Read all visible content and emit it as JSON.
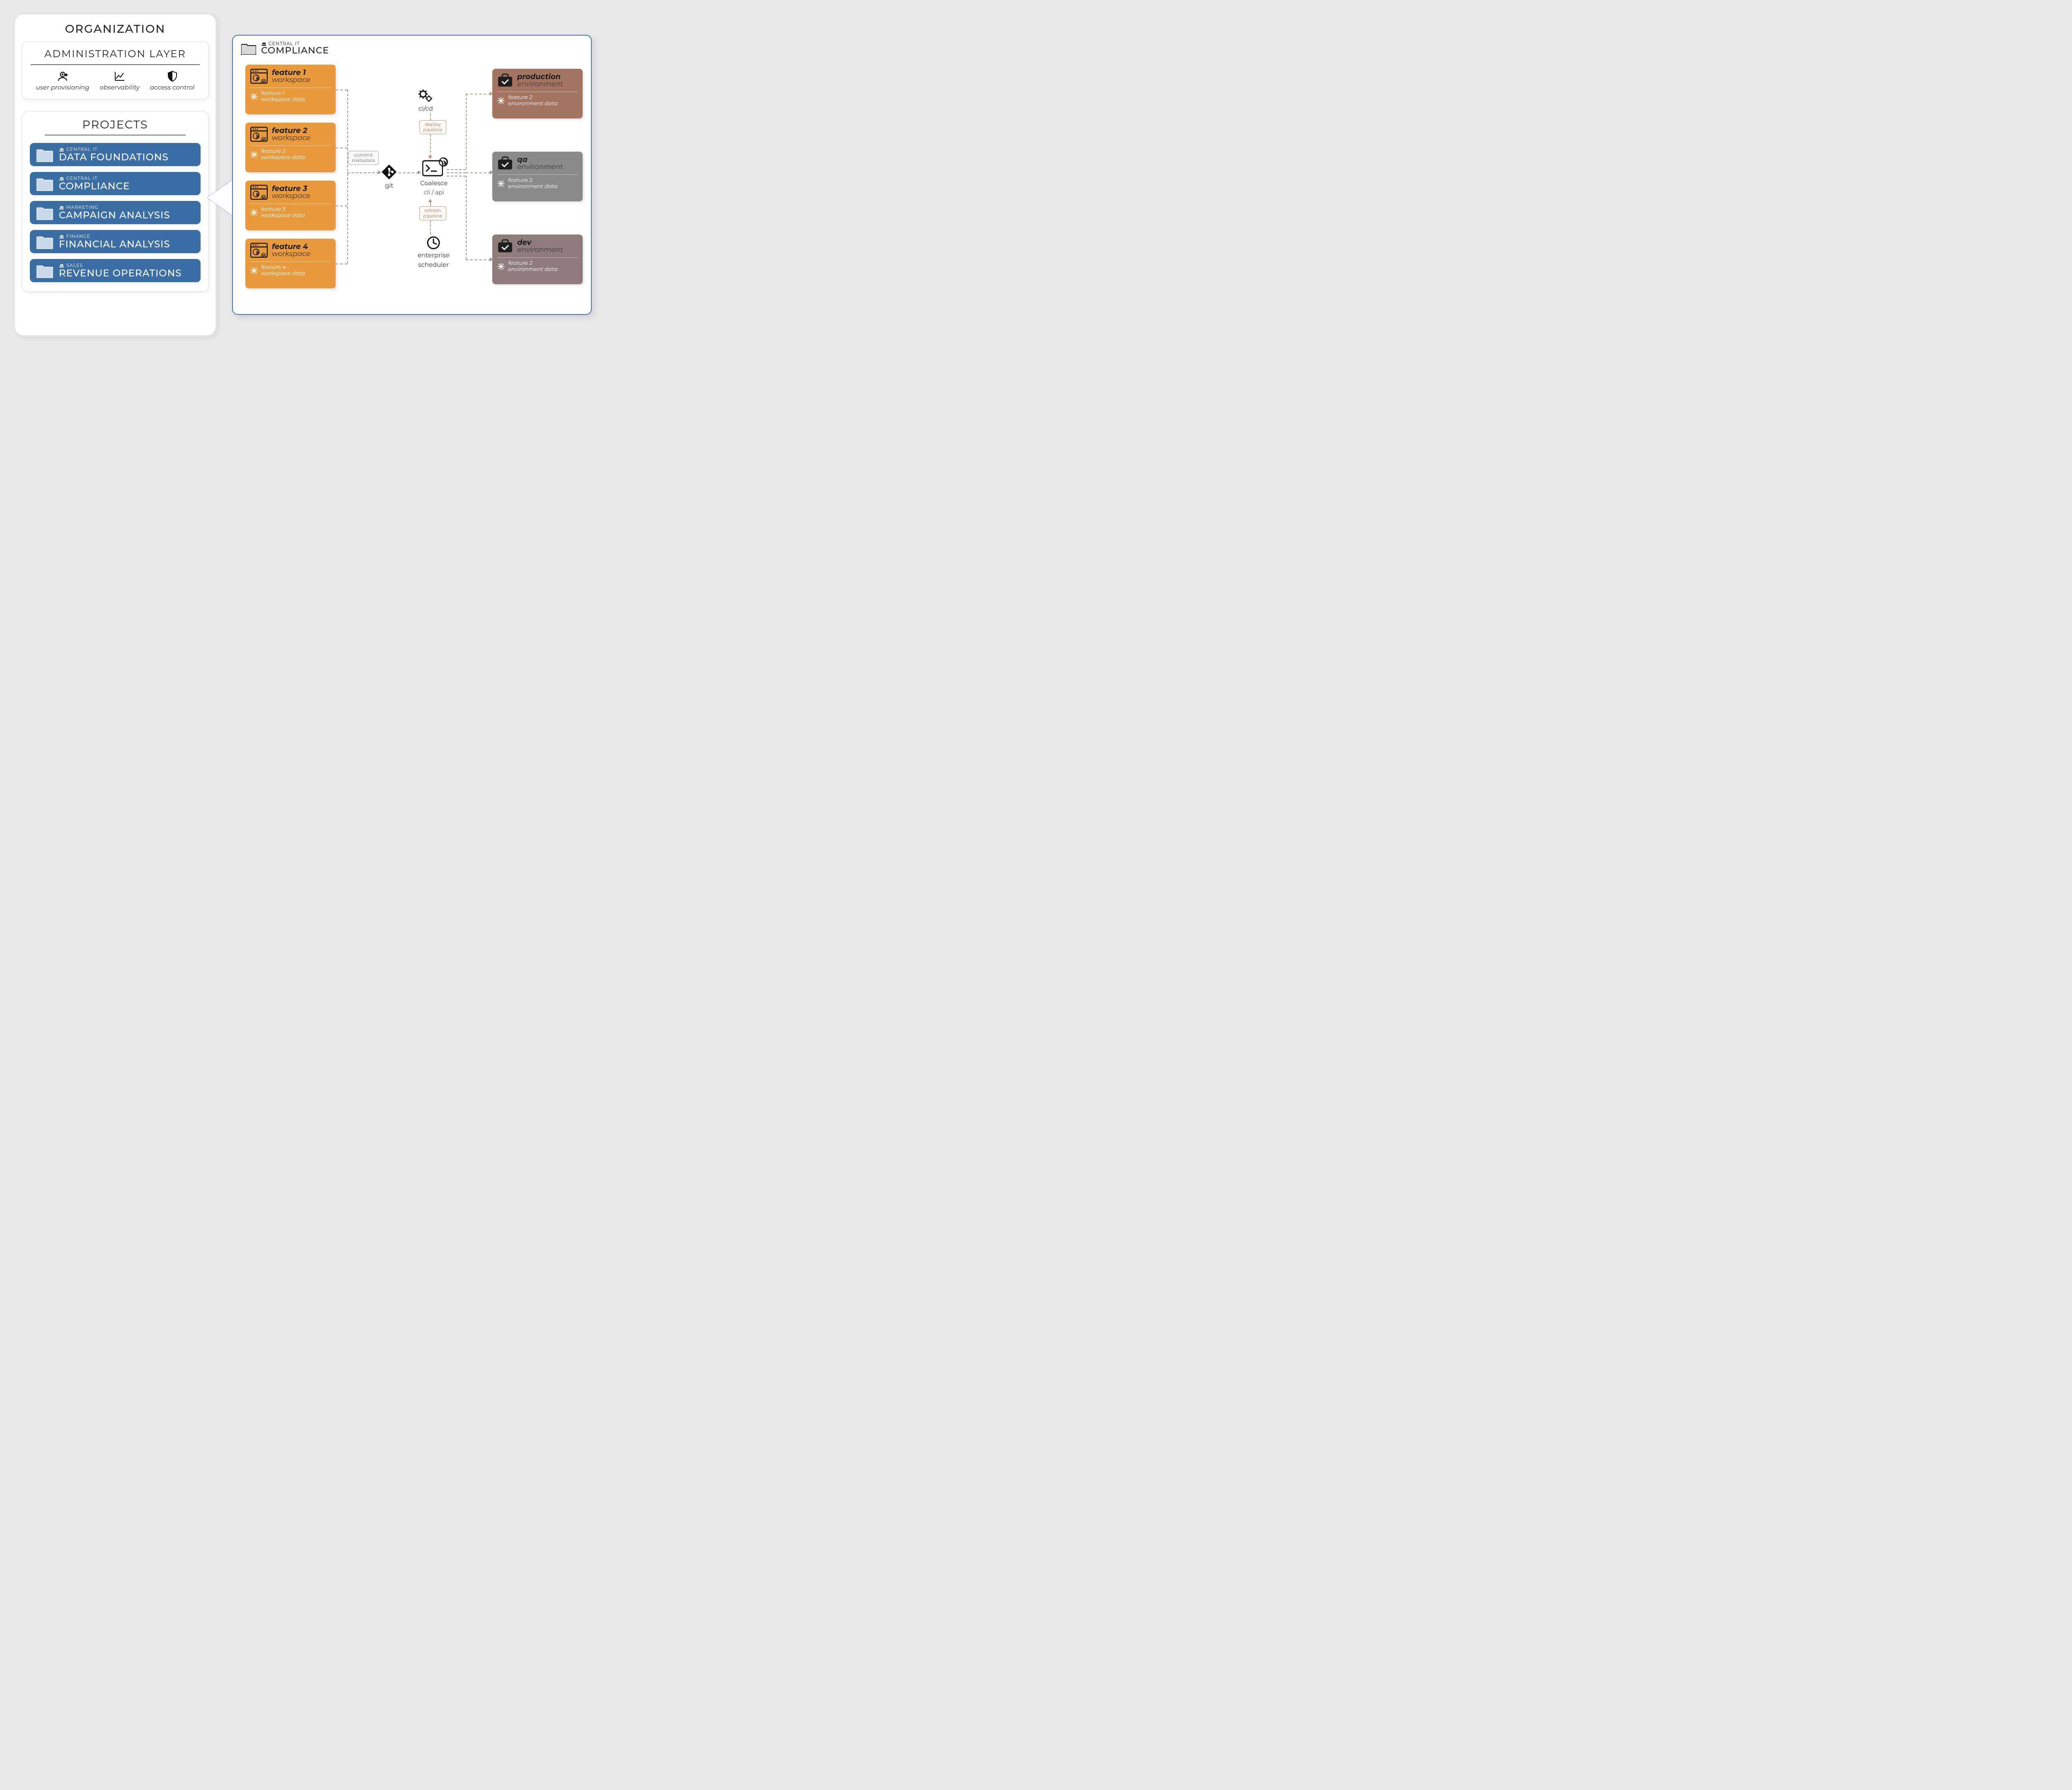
{
  "org": {
    "title": "ORGANIZATION",
    "admin": {
      "title": "ADMINISTRATION LAYER",
      "items": [
        {
          "label": "user provisioning",
          "icon": "user-group-icon"
        },
        {
          "label": "observability",
          "icon": "chart-line-icon"
        },
        {
          "label": "access control",
          "icon": "shield-icon"
        }
      ]
    },
    "projects": {
      "title": "PROJECTS",
      "items": [
        {
          "dept": "CENTRAL IT",
          "name": "DATA FOUNDATIONS"
        },
        {
          "dept": "CENTRAL IT",
          "name": "COMPLIANCE"
        },
        {
          "dept": "MARKETING",
          "name": "CAMPAIGN ANALYSIS"
        },
        {
          "dept": "FINANCE",
          "name": "FINANCIAL ANALYSIS"
        },
        {
          "dept": "SALES",
          "name": "REVENUE OPERATIONS"
        }
      ]
    }
  },
  "detail": {
    "dept": "CENTRAL IT",
    "name": "COMPLIANCE",
    "workspaces": [
      {
        "title": "feature 1",
        "sub": "workspace",
        "data_l1": "feature 1",
        "data_l2": "workspace data"
      },
      {
        "title": "feature 2",
        "sub": "workspace",
        "data_l1": "feature 2",
        "data_l2": "workspace data"
      },
      {
        "title": "feature 3",
        "sub": "workspace",
        "data_l1": "feature 3",
        "data_l2": "workspace data"
      },
      {
        "title": "feature 4",
        "sub": "workspace",
        "data_l1": "feature 4",
        "data_l2": "workspace data"
      }
    ],
    "environments": [
      {
        "title": "production",
        "sub": "environment",
        "data_l1": "feature 2",
        "data_l2": "environment data",
        "variant": "prod"
      },
      {
        "title": "qa",
        "sub": "environment",
        "data_l1": "feature 2",
        "data_l2": "environment data",
        "variant": "qa"
      },
      {
        "title": "dev",
        "sub": "environment",
        "data_l1": "feature 2",
        "data_l2": "environment data",
        "variant": "dev"
      }
    ],
    "pipeline": {
      "commit": "commit\nmetadata",
      "git": "git",
      "cicd": "ci/cd",
      "deploy": "deploy\npipeline",
      "coalesce_l1": "Coalesce",
      "coalesce_l2": "cli / api",
      "refresh": "refresh\npipeline",
      "scheduler_l1": "enterprise",
      "scheduler_l2": "scheduler"
    }
  }
}
